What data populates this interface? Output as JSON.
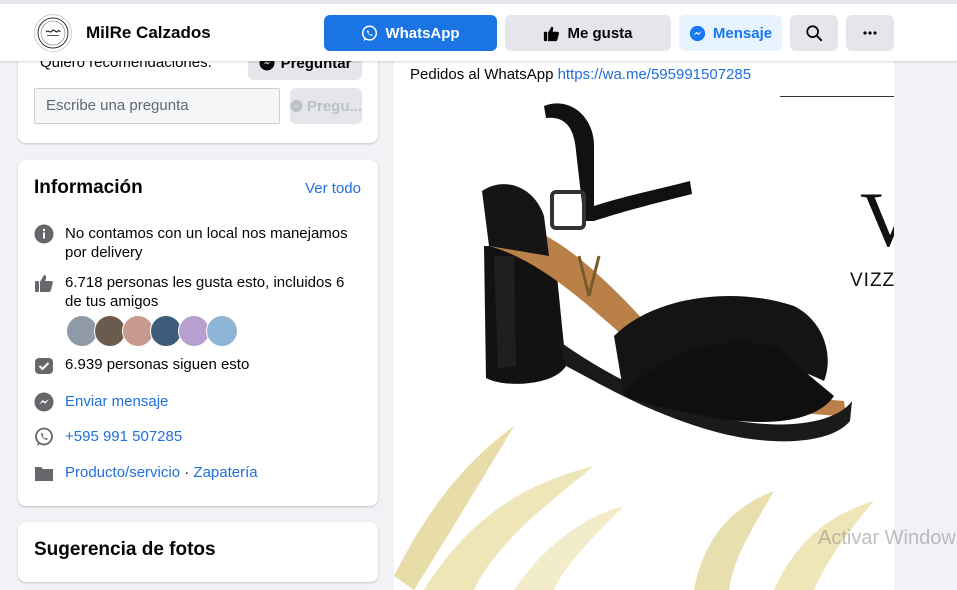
{
  "header": {
    "page_name": "MilRe Calzados",
    "whatsapp_label": "WhatsApp",
    "like_label": "Me gusta",
    "message_label": "Mensaje"
  },
  "question_card": {
    "prompt_text": "Quiero recomendaciones.",
    "ask_button": "Preguntar",
    "input_placeholder": "Escribe una pregunta",
    "send_label": "Pregu..."
  },
  "info": {
    "title": "Información",
    "see_all": "Ver todo",
    "description": "No contamos con un local nos manejamos por delivery",
    "likes": "6.718 personas les gusta esto, incluidos 6 de tus amigos",
    "followers": "6.939 personas siguen esto",
    "send_message": "Enviar mensaje",
    "phone": "+595 991 507285",
    "category_1": "Producto/servicio",
    "category_separator": "·",
    "category_2": "Zapatería"
  },
  "next_card": {
    "title": "Sugerencia de fotos"
  },
  "post": {
    "text_prefix": "Pedidos al WhatsApp",
    "link": "https://wa.me/595991507285",
    "brand_letter": "V",
    "brand_word": "VIZZANO"
  },
  "watermark": "Activar Windows",
  "colors": {
    "primary": "#1b74e4",
    "link": "#216fdb",
    "secondary_button": "#e4e6eb",
    "message_button": "#e7f3ff",
    "page_background": "#f0f2f5"
  },
  "friend_avatar_colors": [
    "#8e9aa8",
    "#6b5a4e",
    "#c79a8e",
    "#3d5b7a",
    "#b7a0d0",
    "#8fb5d6"
  ]
}
